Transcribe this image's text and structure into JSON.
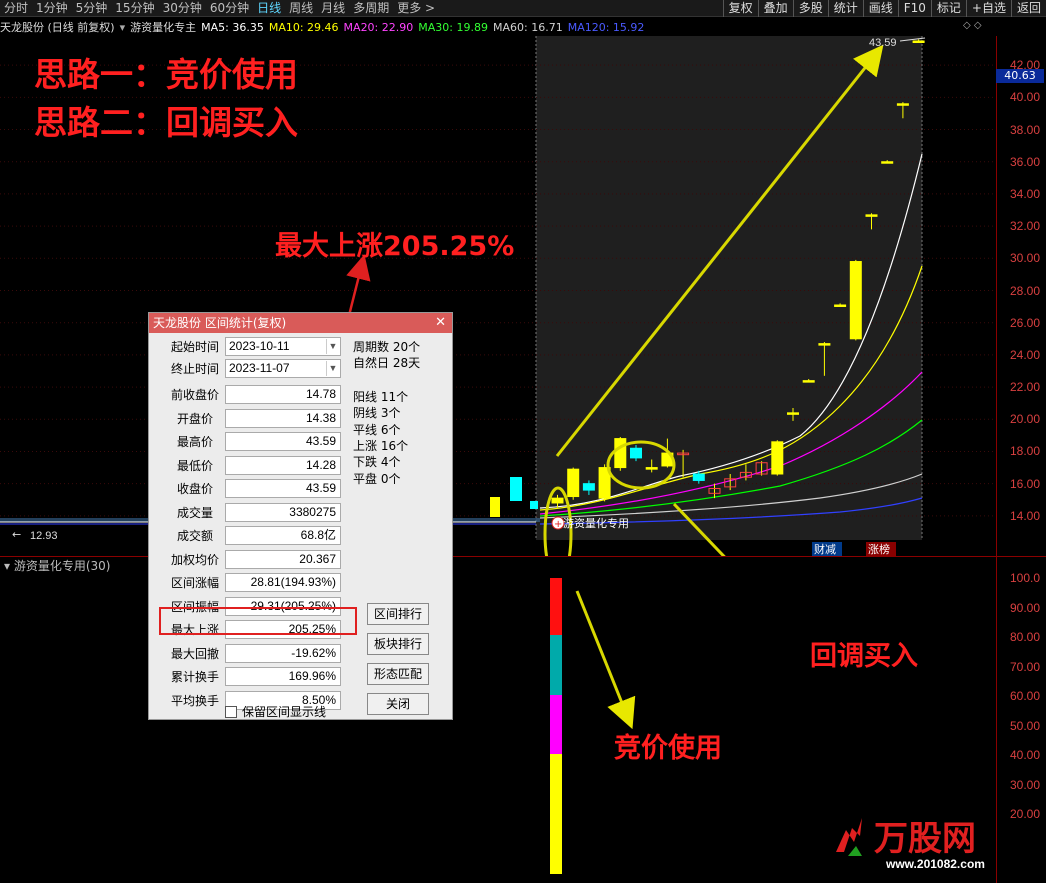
{
  "topbar": {
    "periods": [
      "分时",
      "1分钟",
      "5分钟",
      "15分钟",
      "30分钟",
      "60分钟",
      "日线",
      "周线",
      "月线",
      "多周期",
      "更多 >"
    ],
    "active_period": "日线",
    "right_buttons": [
      "复权",
      "叠加",
      "多股",
      "统计",
      "画线",
      "F10",
      "标记",
      "+自选",
      "返回"
    ]
  },
  "maline": {
    "stock": "天龙股份 (日线 前复权)",
    "indicator": "游资量化专主",
    "ma5": "MA5: 36.35",
    "ma10": "MA10: 29.46",
    "ma20": "MA20: 22.90",
    "ma30": "MA30: 19.89",
    "ma60": "MA60: 16.71",
    "ma120": "MA120: 15.92"
  },
  "colors": {
    "ma5": "#ffffff",
    "ma10": "#ffff00",
    "ma20": "#ff00ff",
    "ma30": "#00ff00",
    "ma60": "#d0d0d0",
    "ma120": "#3040ff",
    "up": "#ffff00",
    "down": "#00ffff",
    "annotation": "#ff2020",
    "dialog_title": "#d95b59"
  },
  "annotations": {
    "idea1": "思路一：竞价使用",
    "idea2": "思路二：回调买入",
    "max_rise": "最大上涨205.25%",
    "pullback": "回调买入",
    "auction": "竞价使用",
    "high_price": "43.59",
    "low_price": "12.93",
    "chart_marker": "游资量化专用",
    "tag_cai": "财减",
    "tag_zhang": "涨榜"
  },
  "yaxis": {
    "current_price": "40.63",
    "ticks": [
      "42.00",
      "40.00",
      "38.00",
      "36.00",
      "34.00",
      "32.00",
      "30.00",
      "28.00",
      "26.00",
      "24.00",
      "22.00",
      "20.00",
      "18.00",
      "16.00",
      "14.00"
    ],
    "sub_ticks": [
      "100.0",
      "90.00",
      "80.00",
      "70.00",
      "60.00",
      "50.00",
      "40.00",
      "30.00",
      "20.00"
    ]
  },
  "subchart": {
    "label": "游资量化专用(30)"
  },
  "dialog": {
    "title": "天龙股份 区间统计(复权)",
    "start_label": "起始时间",
    "start_value": "2023-10-11",
    "end_label": "终止时间",
    "end_value": "2023-11-07",
    "rows": [
      {
        "label": "前收盘价",
        "value": "14.78"
      },
      {
        "label": "开盘价",
        "value": "14.38"
      },
      {
        "label": "最高价",
        "value": "43.59"
      },
      {
        "label": "最低价",
        "value": "14.28"
      },
      {
        "label": "收盘价",
        "value": "43.59"
      },
      {
        "label": "成交量",
        "value": "3380275"
      },
      {
        "label": "成交额",
        "value": "68.8亿"
      },
      {
        "label": "加权均价",
        "value": "20.367"
      },
      {
        "label": "区间涨幅",
        "value": "28.81(194.93%)"
      },
      {
        "label": "区间振幅",
        "value": "29.31(205.25%)"
      },
      {
        "label": "最大上涨",
        "value": "205.25%"
      },
      {
        "label": "最大回撤",
        "value": "-19.62%"
      },
      {
        "label": "累计换手",
        "value": "169.96%"
      },
      {
        "label": "平均换手",
        "value": "8.50%"
      }
    ],
    "stats": [
      "周期数 20个",
      "自然日 28天",
      "阳线 11个",
      "阴线 3个",
      "平线 6个",
      "上涨 16个",
      "下跌 4个",
      "平盘 0个"
    ],
    "buttons": [
      "区间排行",
      "板块排行",
      "形态匹配",
      "关闭"
    ],
    "checkbox": "保留区间显示线"
  },
  "chart_data": {
    "type": "candlestick",
    "ylim": [
      12.5,
      43.5
    ],
    "candles": [
      {
        "o": 14.8,
        "c": 15.1,
        "h": 15.3,
        "l": 14.5
      },
      {
        "o": 15.2,
        "c": 16.9,
        "h": 17.0,
        "l": 15.0
      },
      {
        "o": 16.0,
        "c": 15.6,
        "h": 16.2,
        "l": 15.3
      },
      {
        "o": 15.1,
        "c": 17.0,
        "h": 17.2,
        "l": 14.9
      },
      {
        "o": 17.0,
        "c": 18.8,
        "h": 18.9,
        "l": 16.8
      },
      {
        "o": 18.2,
        "c": 17.6,
        "h": 18.4,
        "l": 17.4
      },
      {
        "o": 16.9,
        "c": 17.0,
        "h": 17.5,
        "l": 16.7
      },
      {
        "o": 17.1,
        "c": 17.9,
        "h": 18.8,
        "l": 17.0
      },
      {
        "o": 17.8,
        "c": 17.9,
        "h": 18.1,
        "l": 16.4
      },
      {
        "o": 16.6,
        "c": 16.2,
        "h": 16.8,
        "l": 16.0
      },
      {
        "o": 15.4,
        "c": 15.7,
        "h": 16.0,
        "l": 15.1
      },
      {
        "o": 15.8,
        "c": 16.3,
        "h": 16.6,
        "l": 15.6
      },
      {
        "o": 16.4,
        "c": 16.7,
        "h": 17.2,
        "l": 16.2
      },
      {
        "o": 16.6,
        "c": 17.3,
        "h": 17.4,
        "l": 16.5
      },
      {
        "o": 16.6,
        "c": 18.6,
        "h": 18.7,
        "l": 16.5
      },
      {
        "o": 20.4,
        "c": 20.4,
        "h": 20.7,
        "l": 19.9
      },
      {
        "o": 22.4,
        "c": 22.4,
        "h": 22.5,
        "l": 22.3
      },
      {
        "o": 24.7,
        "c": 24.7,
        "h": 24.8,
        "l": 22.7
      },
      {
        "o": 27.1,
        "c": 27.1,
        "h": 27.2,
        "l": 27.0
      },
      {
        "o": 25.0,
        "c": 29.8,
        "h": 29.9,
        "l": 24.9
      },
      {
        "o": 32.7,
        "c": 32.7,
        "h": 32.8,
        "l": 31.8
      },
      {
        "o": 36.0,
        "c": 36.0,
        "h": 36.1,
        "l": 35.9
      },
      {
        "o": 39.6,
        "c": 39.6,
        "h": 39.7,
        "l": 38.7
      },
      {
        "o": 43.5,
        "c": 43.5,
        "h": 43.6,
        "l": 43.4
      }
    ]
  }
}
